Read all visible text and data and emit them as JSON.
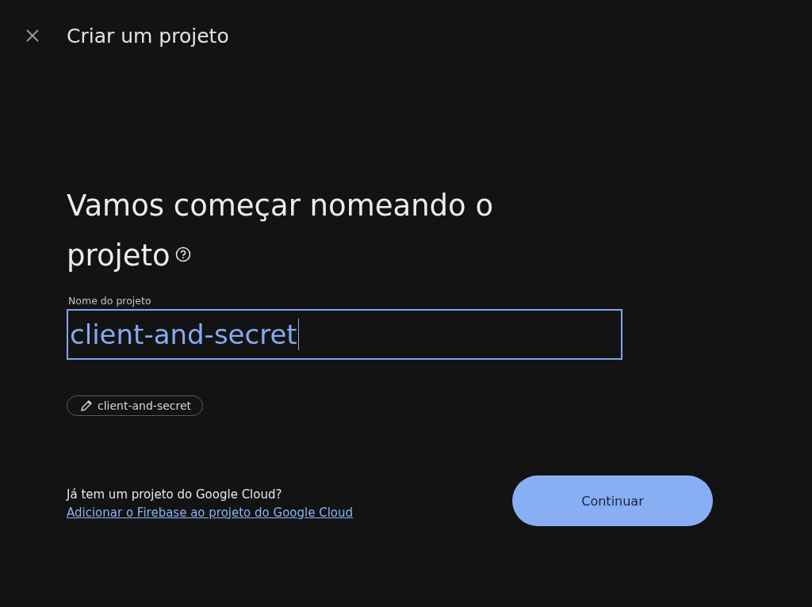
{
  "header": {
    "title": "Criar um projeto"
  },
  "heading": "Vamos começar nomeando o projeto",
  "field": {
    "label": "Nome do projeto",
    "value": "client-and-secret",
    "focused": true
  },
  "project_id_chip": "client-and-secret",
  "footer": {
    "question": "Já tem um projeto do Google Cloud?",
    "link": "Adicionar o Firebase ao projeto do Google Cloud"
  },
  "continue_button": {
    "label": "Continuar",
    "disabled": false
  }
}
